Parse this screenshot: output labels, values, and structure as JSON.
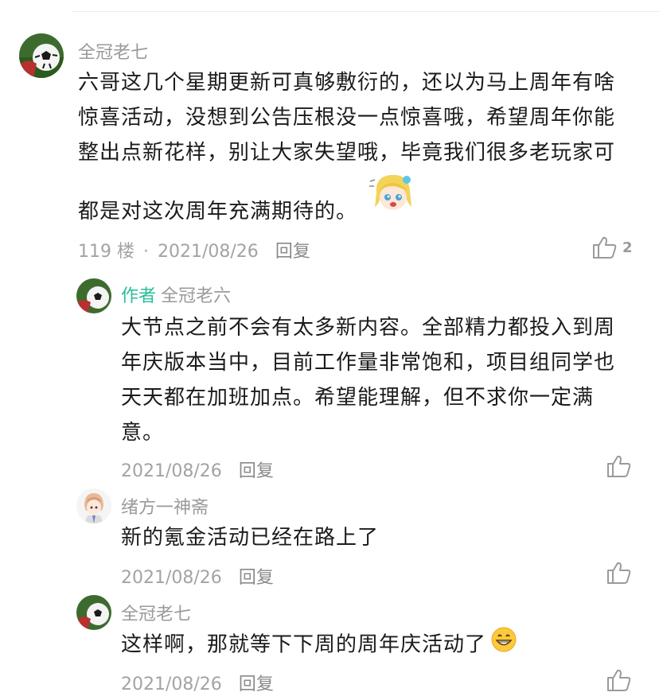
{
  "main_comment": {
    "username": "全冠老七",
    "text": "六哥这几个星期更新可真够敷衍的，还以为马上周年有啥惊喜活动，没想到公告压根没一点惊喜哦，希望周年你能整出点新花样，别让大家失望哦，毕竟我们很多老玩家可都是对这次周年充满期待的。",
    "floor": "119 楼",
    "separator": "·",
    "date": "2021/08/26",
    "reply_label": "回复",
    "like_count": "2",
    "sticker": "anime-girl-sticker"
  },
  "replies": [
    {
      "author_tag": "作者",
      "username": "全冠老六",
      "text": "大节点之前不会有太多新内容。全部精力都投入到周年庆版本当中，目前工作量非常饱和，项目组同学也天天都在加班加点。希望能理解，但不求你一定满意。",
      "date": "2021/08/26",
      "reply_label": "回复"
    },
    {
      "username": "绪方一神斋",
      "text": "新的氪金活动已经在路上了",
      "date": "2021/08/26",
      "reply_label": "回复"
    },
    {
      "username": "全冠老七",
      "text": "这样啊，那就等下下周的周年庆活动了",
      "emoji": "grinning-face",
      "date": "2021/08/26",
      "reply_label": "回复"
    }
  ],
  "colors": {
    "author_accent": "#2bbd9a",
    "meta_gray": "#a3a3a3"
  }
}
